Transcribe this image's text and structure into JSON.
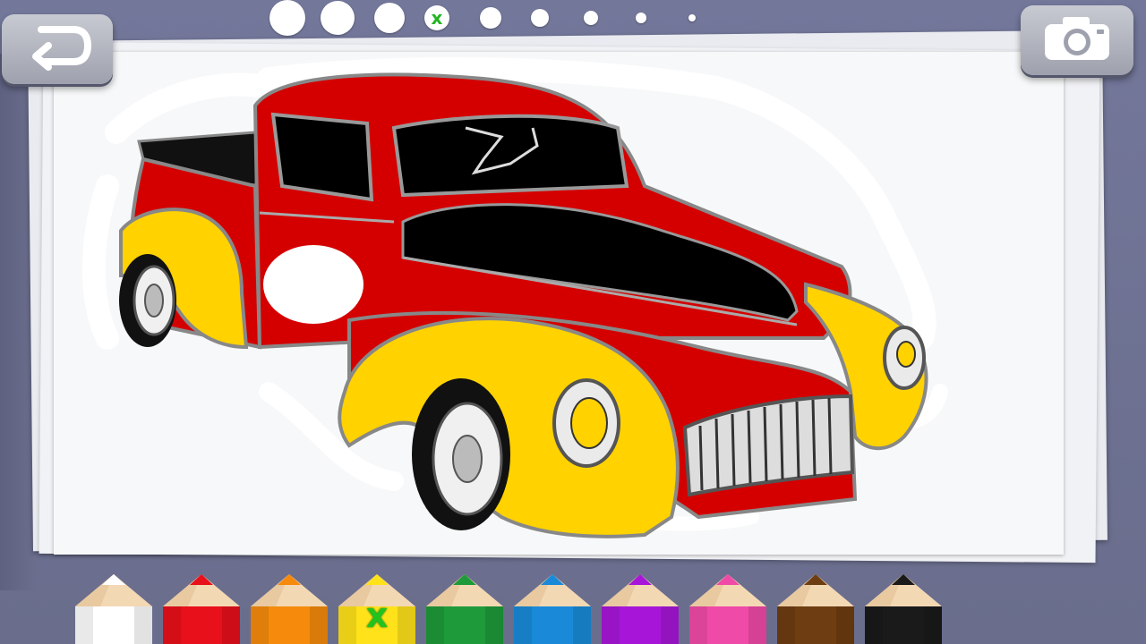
{
  "toolbar": {
    "back_icon": "undo-arrow-icon",
    "camera_icon": "camera-icon"
  },
  "brush_sizes": {
    "selected_index": 3,
    "selected_mark": "x",
    "items": [
      {
        "id": "size-1"
      },
      {
        "id": "size-2"
      },
      {
        "id": "size-3"
      },
      {
        "id": "size-4"
      },
      {
        "id": "size-5"
      },
      {
        "id": "size-6"
      },
      {
        "id": "size-7"
      },
      {
        "id": "size-8"
      },
      {
        "id": "size-9"
      }
    ]
  },
  "palette": {
    "selected_index": 3,
    "selected_mark": "x",
    "colors": [
      {
        "name": "white",
        "hex": "#ffffff"
      },
      {
        "name": "red",
        "hex": "#e8101a"
      },
      {
        "name": "orange",
        "hex": "#f58a0c"
      },
      {
        "name": "yellow",
        "hex": "#ffe21a"
      },
      {
        "name": "green",
        "hex": "#1f9a3a"
      },
      {
        "name": "blue",
        "hex": "#1a8ad8"
      },
      {
        "name": "purple",
        "hex": "#a716d8"
      },
      {
        "name": "pink",
        "hex": "#f04aa8"
      },
      {
        "name": "brown",
        "hex": "#6e3d12"
      },
      {
        "name": "black",
        "hex": "#1a1a1a"
      }
    ]
  },
  "drawing": {
    "subject": "pickup-truck",
    "body_color": "#d00000",
    "fender_color": "#ffd200",
    "hood_color": "#000000"
  }
}
